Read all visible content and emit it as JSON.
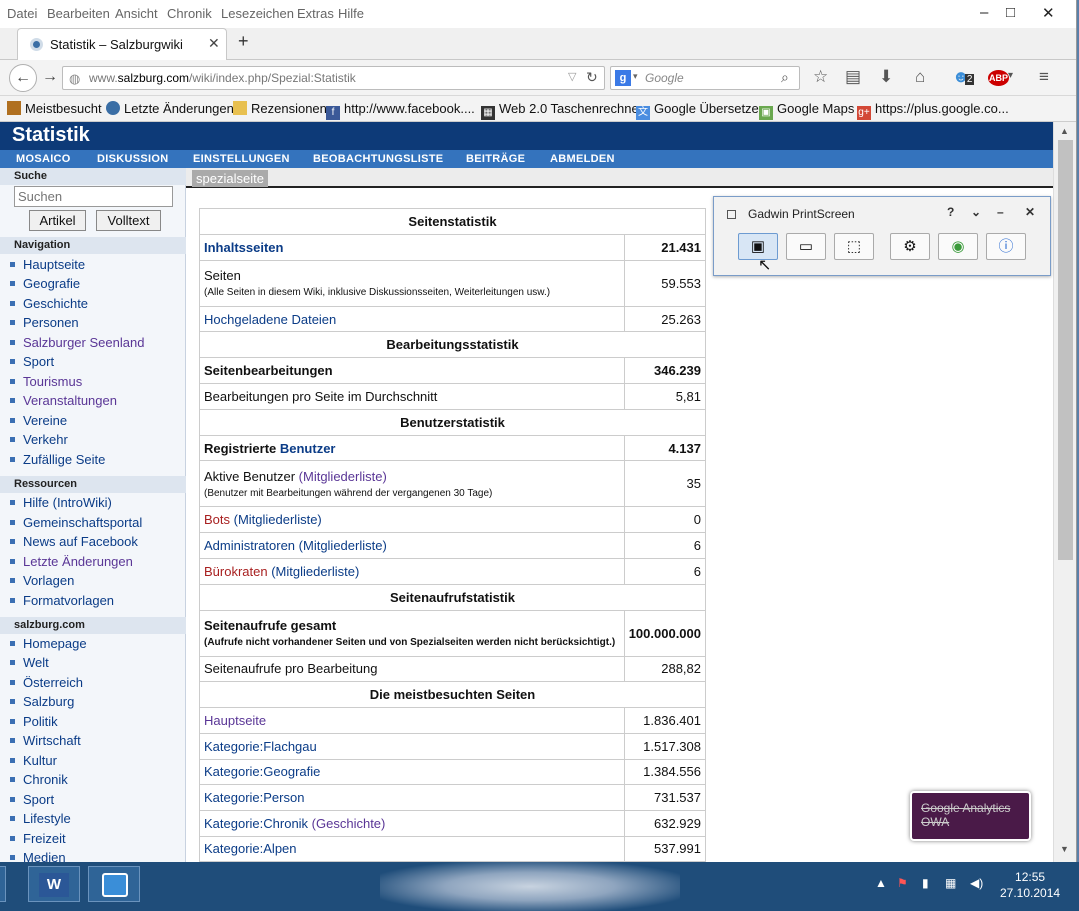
{
  "menu": [
    "Datei",
    "Bearbeiten",
    "Ansicht",
    "Chronik",
    "Lesezeichen",
    "Extras",
    "Hilfe"
  ],
  "window_controls": {
    "minimize": "–",
    "maximize": "□",
    "close": "✕"
  },
  "tab": {
    "title": "Statistik – Salzburgwiki",
    "close": "✕",
    "new": "+"
  },
  "url": {
    "prefix": "www.",
    "host": "salzburg.com",
    "path": "/wiki/index.php/Spezial:Statistik"
  },
  "search": {
    "engine_glyph": "g",
    "placeholder": "Google"
  },
  "toolbar_badge": "2",
  "abp": "ABP",
  "bookmarks": [
    "Meistbesucht",
    "Letzte Änderungen",
    "Rezensionen",
    "http://www.facebook....",
    "Web 2.0 Taschenrechner",
    "Google Übersetzer",
    "Google Maps",
    "https://plus.google.co..."
  ],
  "site_title": "Statistik",
  "wiki_nav": [
    "MOSAICO",
    "DISKUSSION",
    "EINSTELLUNGEN",
    "BEOBACHTUNGSLISTE",
    "BEITRÄGE",
    "ABMELDEN"
  ],
  "subheader": "spezialseite",
  "sidebar": {
    "search_heading": "Suche",
    "search_placeholder": "Suchen",
    "btn_article": "Artikel",
    "btn_fulltext": "Volltext",
    "sections": [
      {
        "heading": "Navigation",
        "items": [
          "Hauptseite",
          "Geografie",
          "Geschichte",
          "Personen",
          "Salzburger Seenland",
          "Sport",
          "Tourismus",
          "Veranstaltungen",
          "Vereine",
          "Verkehr",
          "Zufällige Seite"
        ]
      },
      {
        "heading": "Ressourcen",
        "items": [
          "Hilfe (IntroWiki)",
          "Gemeinschaftsportal",
          "News auf Facebook",
          "Letzte Änderungen",
          "Vorlagen",
          "Formatvorlagen"
        ]
      },
      {
        "heading": "salzburg.com",
        "items": [
          "Homepage",
          "Welt",
          "Österreich",
          "Salzburg",
          "Politik",
          "Wirtschaft",
          "Kultur",
          "Chronik",
          "Sport",
          "Lifestyle",
          "Freizeit",
          "Medien"
        ]
      }
    ]
  },
  "stats": {
    "h_pages": "Seitenstatistik",
    "content_pages": {
      "label": "Inhaltsseiten",
      "value": "21.431"
    },
    "pages": {
      "label": "Seiten",
      "note": "(Alle Seiten in diesem Wiki, inklusive Diskussionsseiten, Weiterleitungen usw.)",
      "value": "59.553"
    },
    "uploads": {
      "label": "Hochgeladene Dateien",
      "value": "25.263"
    },
    "h_edits": "Bearbeitungsstatistik",
    "edits": {
      "label": "Seitenbearbeitungen",
      "value": "346.239"
    },
    "edits_avg": {
      "label": "Bearbeitungen pro Seite im Durchschnitt",
      "value": "5,81"
    },
    "h_users": "Benutzerstatistik",
    "reg_users": {
      "label_a": "Registrierte ",
      "label_b": "Benutzer",
      "value": "4.137"
    },
    "active_users": {
      "label": "Aktive Benutzer ",
      "link": "(Mitgliederliste)",
      "note": "(Benutzer mit Bearbeitungen während der vergangenen 30 Tage)",
      "value": "35"
    },
    "bots": {
      "label": "Bots",
      "link": " (Mitgliederliste)",
      "value": "0"
    },
    "admins": {
      "label": "Administratoren",
      "link": " (Mitgliederliste)",
      "value": "6"
    },
    "bureaucrats": {
      "label": "Bürokraten",
      "link": " (Mitgliederliste)",
      "value": "6"
    },
    "h_views": "Seitenaufrufstatistik",
    "views_total": {
      "label": "Seitenaufrufe gesamt",
      "note": "(Aufrufe nicht vorhandener Seiten und von Spezialseiten werden nicht berücksichtigt.)",
      "value": "100.000.000"
    },
    "views_per_edit": {
      "label": "Seitenaufrufe pro Bearbeitung",
      "value": "288,82"
    },
    "h_top": "Die meistbesuchten Seiten",
    "top": [
      {
        "label": "Hauptseite",
        "extra": "",
        "value": "1.836.401"
      },
      {
        "label": "Kategorie:Flachgau",
        "extra": "",
        "value": "1.517.308"
      },
      {
        "label": "Kategorie:Geografie",
        "extra": "",
        "value": "1.384.556"
      },
      {
        "label": "Kategorie:Person",
        "extra": "",
        "value": "731.537"
      },
      {
        "label": "Kategorie:Chronik",
        "extra": " (Geschichte)",
        "value": "632.929"
      },
      {
        "label": "Kategorie:Alpen",
        "extra": "",
        "value": "537.991"
      }
    ]
  },
  "gadwin": {
    "title": "Gadwin PrintScreen",
    "help": "?"
  },
  "analytics": {
    "line1": "Google Analytics",
    "line2": "OWA"
  },
  "clock": {
    "time": "12:55",
    "date": "27.10.2014"
  }
}
